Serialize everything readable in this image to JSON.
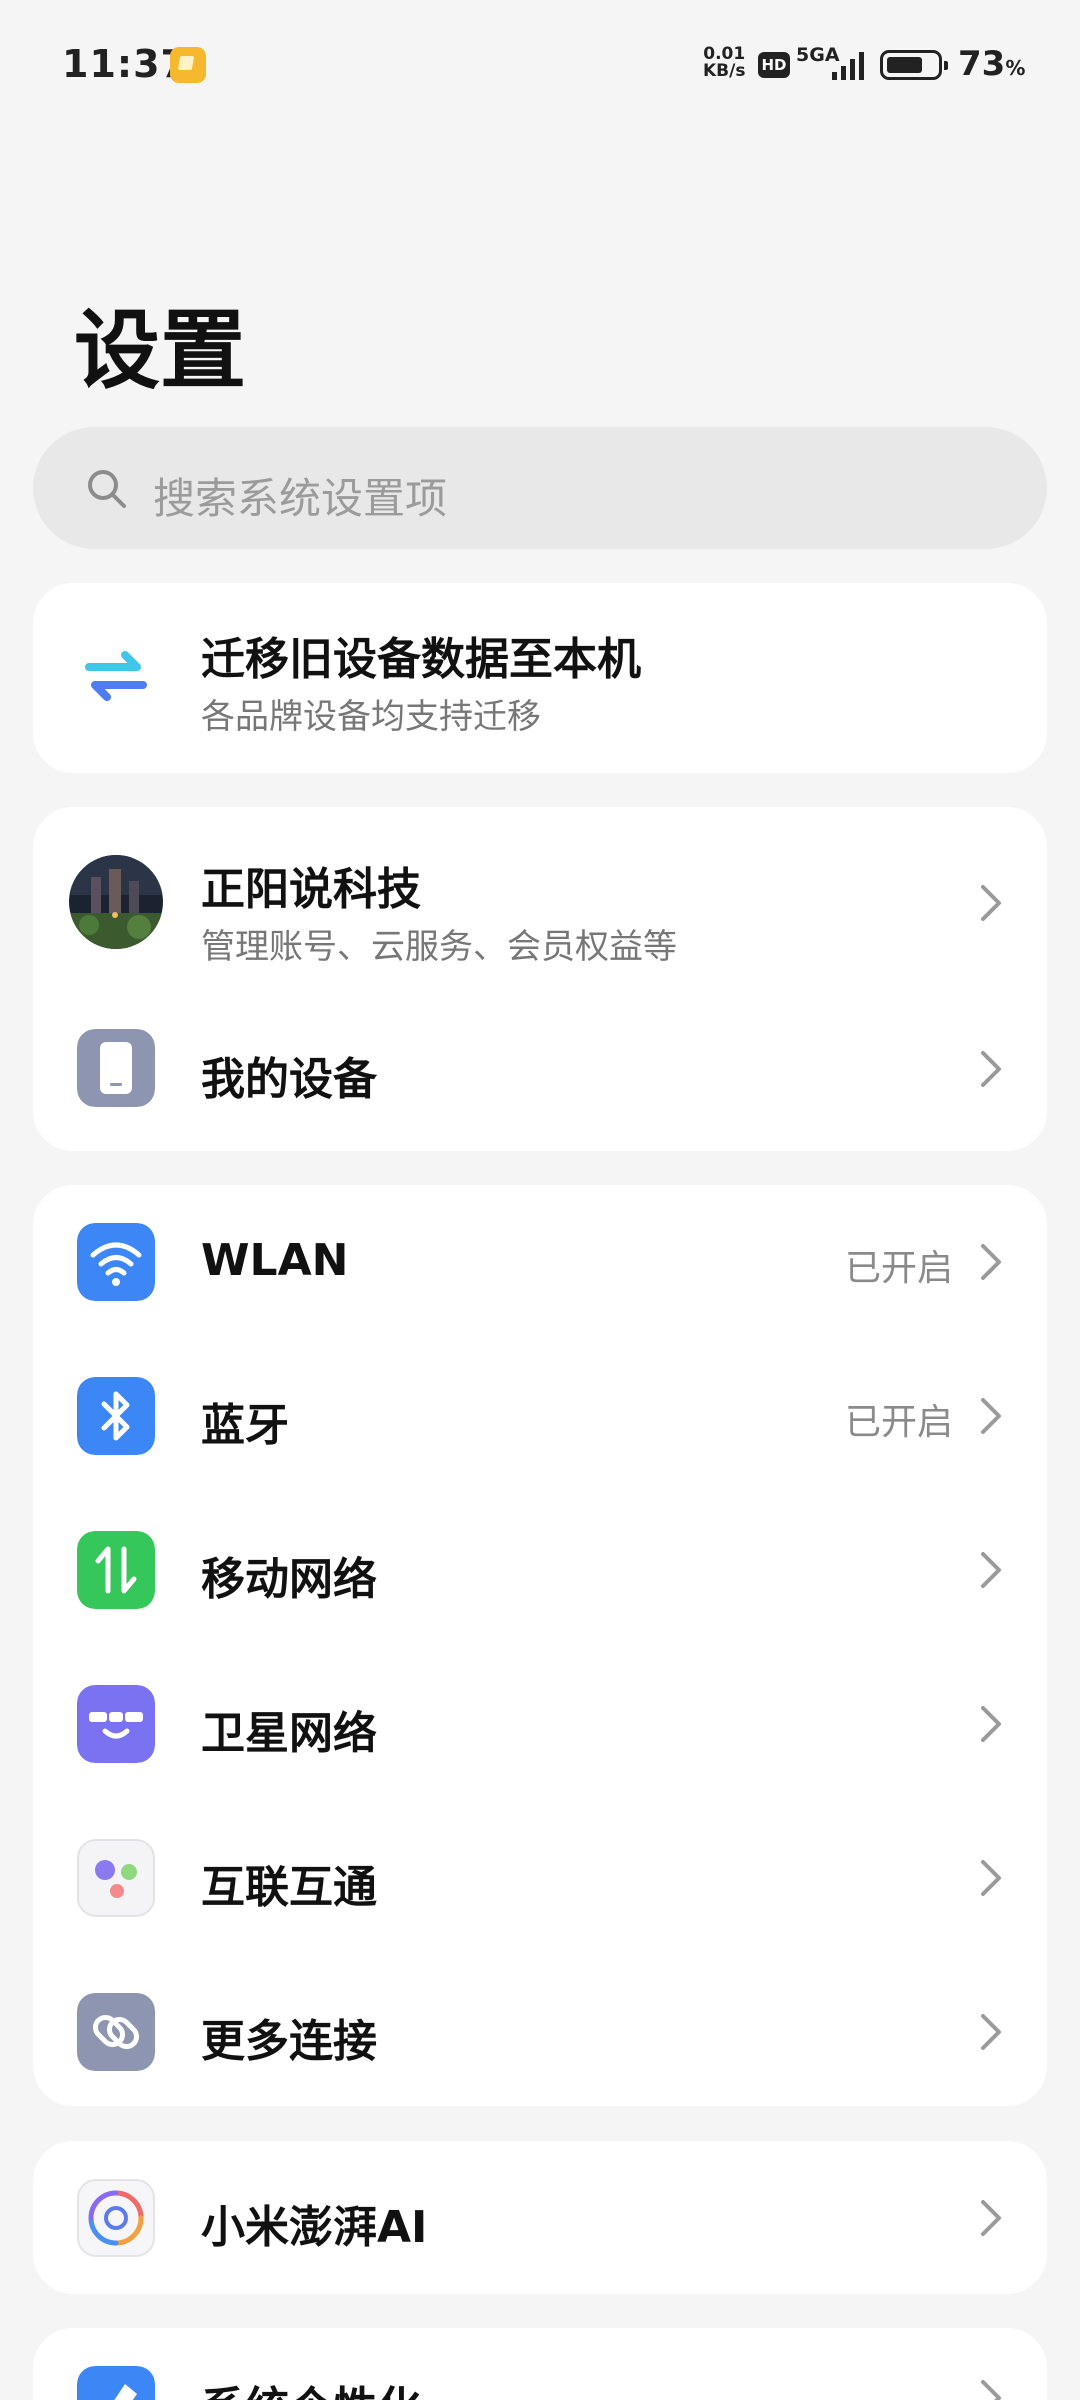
{
  "status_bar": {
    "time": "11:37",
    "speed_value": "0.01",
    "speed_unit": "KB/s",
    "hd": "HD",
    "network": "5GA",
    "battery_percent": "73",
    "battery_unit": "%",
    "battery_level": 0.73
  },
  "title": "设置",
  "search": {
    "placeholder": "搜索系统设置项",
    "icon": "search-icon"
  },
  "migrate": {
    "title": "迁移旧设备数据至本机",
    "subtitle": "各品牌设备均支持迁移",
    "icon": "transfer-arrows-icon",
    "colors": [
      "#3ec7e8",
      "#4f7cf5"
    ]
  },
  "account": {
    "name": "正阳说科技",
    "subtitle": "管理账号、云服务、会员权益等",
    "my_device": "我的设备"
  },
  "connections": [
    {
      "label": "WLAN",
      "status": "已开启",
      "icon": "wifi-icon",
      "color": "#3c87f5"
    },
    {
      "label": "蓝牙",
      "status": "已开启",
      "icon": "bluetooth-icon",
      "color": "#3c87f5"
    },
    {
      "label": "移动网络",
      "status": "",
      "icon": "mobile-data-icon",
      "color": "#35c75a"
    },
    {
      "label": "卫星网络",
      "status": "",
      "icon": "satellite-icon",
      "color": "#7a72f0"
    },
    {
      "label": "互联互通",
      "status": "",
      "icon": "interconnect-icon",
      "color": "#f4f4f6"
    },
    {
      "label": "更多连接",
      "status": "",
      "icon": "link-icon",
      "color": "#8e95b0"
    }
  ],
  "ai": {
    "label": "小米澎湃AI",
    "icon": "hyperai-icon"
  },
  "personalize": {
    "label": "系统个性化",
    "icon": "personalize-icon"
  }
}
